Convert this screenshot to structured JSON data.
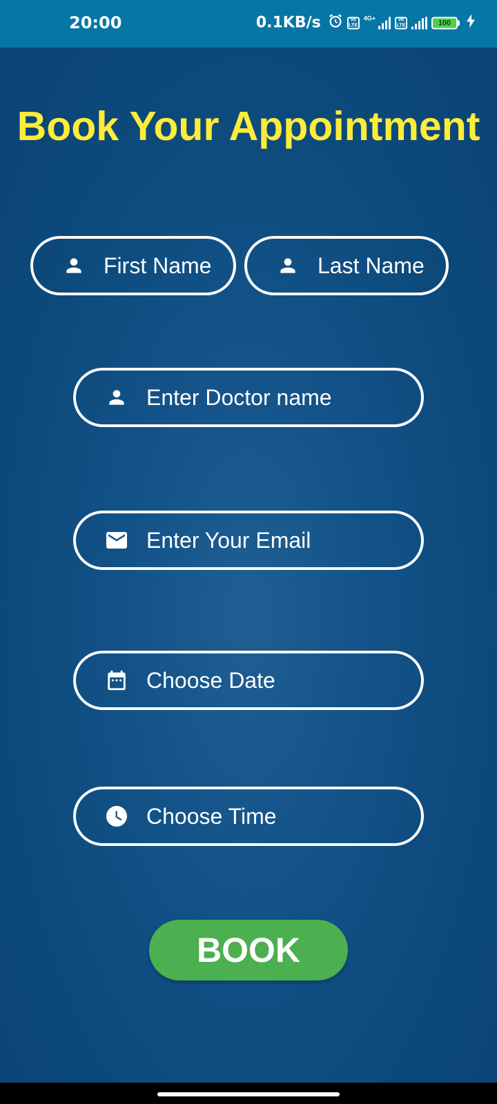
{
  "status_bar": {
    "time": "20:00",
    "net_speed": "0.1KB/s",
    "net_type": "4G+",
    "volte_top": "Vo",
    "volte_bottom": "LTE",
    "battery": "100"
  },
  "title": "Book Your Appointment",
  "form": {
    "first_name": {
      "placeholder": "First Name",
      "icon": "person-icon"
    },
    "last_name": {
      "placeholder": "Last Name",
      "icon": "person-icon"
    },
    "doctor": {
      "placeholder": "Enter Doctor name",
      "icon": "person-icon"
    },
    "email": {
      "placeholder": "Enter Your Email",
      "icon": "mail-icon"
    },
    "date": {
      "placeholder": "Choose Date",
      "icon": "calendar-icon"
    },
    "time": {
      "placeholder": "Choose Time",
      "icon": "clock-icon"
    }
  },
  "book_button": "BOOK",
  "colors": {
    "background": "#0b4a7a",
    "status_bar": "#0676a6",
    "title": "#fdec3a",
    "button": "#4caf50",
    "field_border": "#ffffff"
  }
}
